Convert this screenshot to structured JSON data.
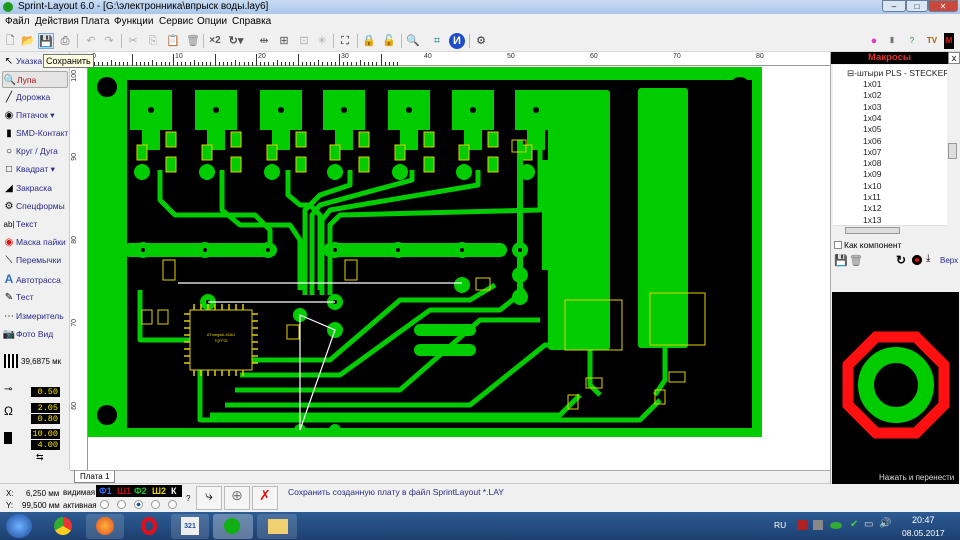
{
  "window": {
    "title": "Sprint-Layout 6.0 - [G:\\электронника\\впрыск воды.lay6]",
    "minimize": "–",
    "maximize": "□",
    "close": "✕"
  },
  "menu": [
    "Файл",
    "Действия",
    "Плата",
    "Функции",
    "Сервис",
    "Опции",
    "Справка"
  ],
  "toolbar": {
    "tooltip": "Сохранить",
    "x2_label": "×2",
    "icons": [
      "new-icon",
      "open-icon",
      "save-icon",
      "print-icon",
      "undo-icon",
      "redo-icon",
      "cut-icon",
      "copy-icon",
      "paste-icon",
      "delete-icon",
      "duplicate-icon",
      "rotate-icon",
      "mirror-icon",
      "align-icon",
      "group-icon",
      "snap-icon",
      "components-icon",
      "lock-icon",
      "unlock-icon",
      "zoom-icon",
      "crop-icon",
      "info-icon",
      "gear-icon"
    ]
  },
  "tools": [
    {
      "label": "Указка",
      "icon": "pointer-icon"
    },
    {
      "label": "Лупа",
      "icon": "magnifier-icon"
    },
    {
      "label": "Дорожка",
      "icon": "track-icon"
    },
    {
      "label": "Пятачок",
      "icon": "pad-icon"
    },
    {
      "label": "SMD-Контакт",
      "icon": "smd-icon"
    },
    {
      "label": "Круг / Дуга",
      "icon": "circle-icon"
    },
    {
      "label": "Квадрат",
      "icon": "square-icon"
    },
    {
      "label": "Закраска",
      "icon": "fill-icon"
    },
    {
      "label": "Спецформы",
      "icon": "special-shapes-icon"
    },
    {
      "label": "Текст",
      "icon": "text-icon"
    },
    {
      "label": "Маска пайки",
      "icon": "solder-mask-icon"
    },
    {
      "label": "Перемычки",
      "icon": "jumper-icon"
    },
    {
      "label": "Автотрасса",
      "icon": "autoroute-icon"
    },
    {
      "label": "Тест",
      "icon": "test-icon"
    },
    {
      "label": "Измеритель",
      "icon": "measure-icon"
    },
    {
      "label": "Фото Вид",
      "icon": "photo-view-icon"
    }
  ],
  "grid": {
    "value": "39,6875 мк"
  },
  "params": {
    "track_width": "0.50",
    "pad_outer": "2.05",
    "pad_inner": "0.80",
    "smd_width": "10.00",
    "smd_height": "4.00"
  },
  "rulers": {
    "h": [
      "0",
      "10",
      "20",
      "30",
      "40",
      "50",
      "60",
      "70",
      "80"
    ],
    "v": [
      "100",
      "90",
      "80",
      "70",
      "60"
    ]
  },
  "board": {
    "tab": "Плата 1",
    "chip_label": "ATmega8-16AU",
    "chip_package": "TQFP32",
    "copper_color": "#00cc00",
    "silk_color": "#e0d000",
    "air_wire_color": "#ffffff"
  },
  "status": {
    "x_label": "X:",
    "x_value": "6,250 мм",
    "y_label": "Y:",
    "y_value": "99,500 мм",
    "visible_label": "видимая",
    "active_label": "активная",
    "layers": [
      {
        "name": "Ф1",
        "color": "#2a6cff"
      },
      {
        "name": "Ш1",
        "color": "#c01010"
      },
      {
        "name": "Ф2",
        "color": "#20c020"
      },
      {
        "name": "Ш2",
        "color": "#e0d000"
      },
      {
        "name": "К",
        "color": "#ffffff"
      }
    ],
    "active_layer": 2,
    "help": "?",
    "message": "Сохранить созданную плату в файл SprintLayout *.LAY"
  },
  "macros": {
    "title": "Макросы",
    "close": "x",
    "group": "штыри PLS - STECKER",
    "items": [
      "1x01",
      "1x02",
      "1x03",
      "1x04",
      "1x05",
      "1x06",
      "1x07",
      "1x08",
      "1x09",
      "1x10",
      "1x11",
      "1x12",
      "1x13"
    ],
    "as_component": "Как компонент",
    "top_label": "Верх",
    "preview_hint": "Нажать и перенести"
  },
  "taskbar": {
    "lang": "RU",
    "time": "20:47",
    "date": "08.05.2017"
  }
}
